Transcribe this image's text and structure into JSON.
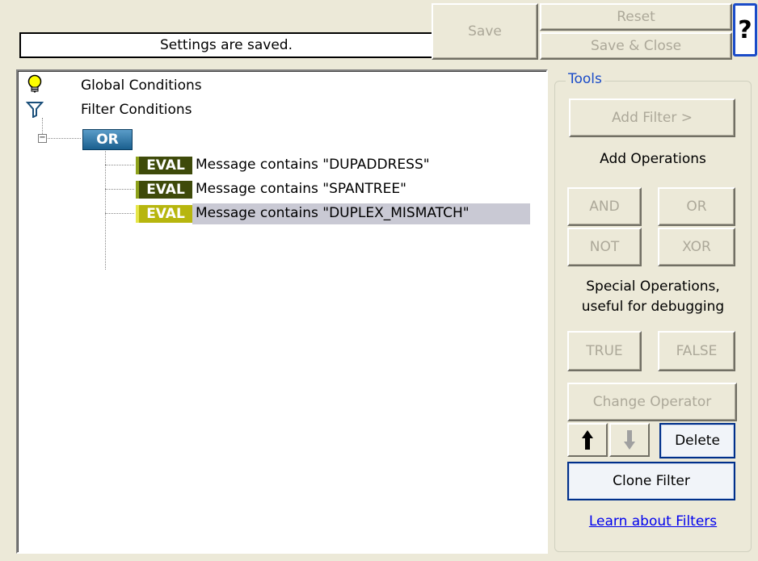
{
  "status": {
    "text": "Settings are saved."
  },
  "toolbar": {
    "save_label": "Save",
    "reset_label": "Reset",
    "save_close_label": "Save & Close",
    "help_label": "?"
  },
  "tree": {
    "global_conditions": "Global Conditions",
    "filter_conditions": "Filter Conditions",
    "operator": "OR",
    "expander": "−",
    "eval_tag": "EVAL",
    "conditions": [
      "Message contains \"DUPADDRESS\"",
      "Message contains \"SPANTREE\"",
      "Message contains \"DUPLEX_MISMATCH\""
    ]
  },
  "tools": {
    "title": "Tools",
    "add_filter": "Add Filter >",
    "add_operations": "Add Operations",
    "and": "AND",
    "or": "OR",
    "not": "NOT",
    "xor": "XOR",
    "special_1": "Special Operations,",
    "special_2": "useful for debugging",
    "true": "TRUE",
    "false": "FALSE",
    "change_operator": "Change Operator",
    "delete": "Delete",
    "clone_filter": "Clone Filter",
    "learn_link": "Learn about Filters"
  },
  "colors": {
    "window_bg": "#ece9d8",
    "link": "#0000ee",
    "group_title": "#1a4bc8",
    "or_tag": "#1a5f8e",
    "eval_tag": "#3e4a0a",
    "eval_tag_selected": "#b7b60e",
    "selection": "#c9c9d4"
  },
  "icons": {
    "global": "lightbulb-icon",
    "filter": "funnel-icon",
    "up": "arrow-up-icon",
    "down": "arrow-down-icon"
  }
}
